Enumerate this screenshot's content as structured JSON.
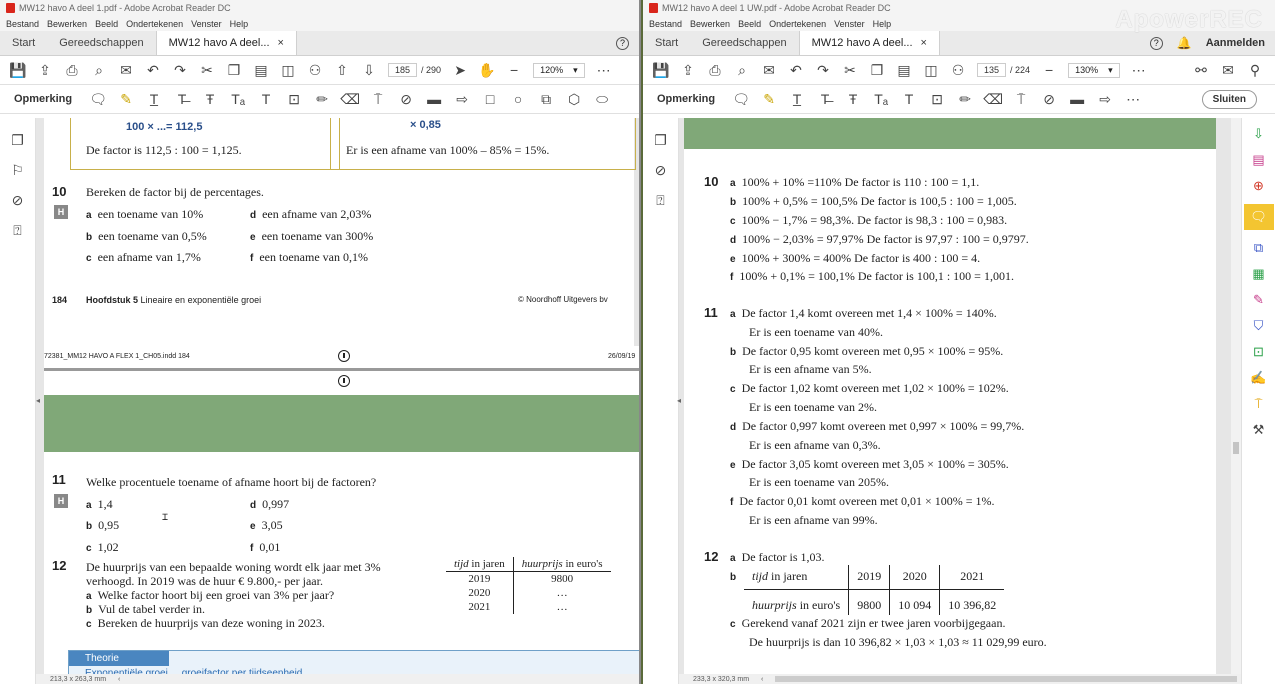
{
  "watermark": "ApowerREC",
  "left": {
    "title": "MW12 havo A deel 1.pdf - Adobe Acrobat Reader DC",
    "menu": [
      "Bestand",
      "Bewerken",
      "Beeld",
      "Ondertekenen",
      "Venster",
      "Help"
    ],
    "tabs": {
      "start": "Start",
      "tools": "Gereedschappen",
      "doc": "MW12 havo A deel...",
      "close": "×"
    },
    "page_current": "185",
    "page_total": "/ 290",
    "zoom": "120%",
    "annot_label": "Opmerking",
    "content": {
      "top_eq_left": "100 × ...= 112,5",
      "top_eq_right": "× 0,85",
      "factor_left": "De factor is 112,5 : 100 = 1,125.",
      "factor_right": "Er is een afname van 100% – 85% = 15%.",
      "q10_num": "10",
      "q10_text": "Bereken de factor bij de percentages.",
      "q10_items": [
        {
          "l": "a",
          "t": "een toename van 10%"
        },
        {
          "l": "d",
          "t": "een afname van 2,03%"
        },
        {
          "l": "b",
          "t": "een toename van 0,5%"
        },
        {
          "l": "e",
          "t": "een toename van 300%"
        },
        {
          "l": "c",
          "t": "een afname van 1,7%"
        },
        {
          "l": "f",
          "t": "een toename van 0,1%"
        }
      ],
      "h_label": "H",
      "footer_page": "184",
      "footer_chapter_bold": "Hoofdstuk 5",
      "footer_chapter": "Lineaire en exponentiële groei",
      "footer_publisher": "© Noordhoff Uitgevers bv",
      "indd_file": "72381_MM12 HAVO A FLEX 1_CH05.indd 184",
      "indd_date": "26/09/19",
      "q11_num": "11",
      "q11_text": "Welke procentuele toename of afname hoort bij de factoren?",
      "q11_items": [
        {
          "l": "a",
          "t": "1,4"
        },
        {
          "l": "d",
          "t": "0,997"
        },
        {
          "l": "b",
          "t": "0,95"
        },
        {
          "l": "e",
          "t": "3,05"
        },
        {
          "l": "c",
          "t": "1,02"
        },
        {
          "l": "f",
          "t": "0,01"
        }
      ],
      "q12_num": "12",
      "q12_line1": "De huurprijs van een bepaalde woning wordt elk jaar met 3%",
      "q12_line2": "verhoogd. In 2019 was de huur € 9.800,- per jaar.",
      "q12_a": "Welke factor hoort bij een groei van 3% per jaar?",
      "q12_b": "Vul de tabel verder in.",
      "q12_c": "Bereken de huurprijs van deze woning in 2023.",
      "table_head_1a": "tijd",
      "table_head_1b": " in jaren",
      "table_head_2a": "huurprijs",
      "table_head_2b": " in euro's",
      "table_rows": [
        [
          "2019",
          "9800"
        ],
        [
          "2020",
          "…"
        ],
        [
          "2021",
          "…"
        ]
      ],
      "theorie": "Theorie",
      "theorie_sub": "Exponentiële groei ... groeifactor per tijdseenheid"
    },
    "status_size": "213,3 x 263,3 mm"
  },
  "right": {
    "title": "MW12 havo A deel 1 UW.pdf - Adobe Acrobat Reader DC",
    "menu": [
      "Bestand",
      "Bewerken",
      "Beeld",
      "Ondertekenen",
      "Venster",
      "Help"
    ],
    "tabs": {
      "start": "Start",
      "tools": "Gereedschappen",
      "doc": "MW12 havo A deel...",
      "close": "×"
    },
    "aanmelden": "Aanmelden",
    "page_current": "135",
    "page_total": "/ 224",
    "zoom": "130%",
    "annot_label": "Opmerking",
    "sluiten": "Sluiten",
    "content": {
      "a10_num": "10",
      "a10": [
        {
          "l": "a",
          "t": "100% + 10% =110% De factor is 110 : 100 = 1,1."
        },
        {
          "l": "b",
          "t": "100% + 0,5% = 100,5% De factor is 100,5 : 100 = 1,005."
        },
        {
          "l": "c",
          "t": "100% − 1,7% = 98,3%. De factor is 98,3 : 100 = 0,983."
        },
        {
          "l": "d",
          "t": "100% − 2,03% = 97,97% De factor is 97,97 : 100 = 0,9797."
        },
        {
          "l": "e",
          "t": "100% + 300% = 400% De factor is 400 : 100 = 4."
        },
        {
          "l": "f",
          "t": "100% + 0,1% = 100,1% De factor is 100,1 : 100 = 1,001."
        }
      ],
      "a11_num": "11",
      "a11": [
        {
          "l": "a",
          "t1": "De factor 1,4 komt overeen met 1,4 × 100% = 140%.",
          "t2": "Er is een toename van 40%."
        },
        {
          "l": "b",
          "t1": "De factor 0,95 komt overeen met 0,95 × 100% = 95%.",
          "t2": "Er is een afname van 5%."
        },
        {
          "l": "c",
          "t1": "De factor 1,02 komt overeen met 1,02 × 100% = 102%.",
          "t2": "Er is een toename van 2%."
        },
        {
          "l": "d",
          "t1": "De factor 0,997 komt overeen met 0,997 × 100% = 99,7%.",
          "t2": "Er is een afname van 0,3%."
        },
        {
          "l": "e",
          "t1": "De factor 3,05 komt overeen met 3,05 × 100% = 305%.",
          "t2": "Er is een toename van 205%."
        },
        {
          "l": "f",
          "t1": "De factor 0,01 komt overeen met 0,01 × 100% = 1%.",
          "t2": "Er is een afname van 99%."
        }
      ],
      "a12_num": "12",
      "a12_a": "De factor is 1,03.",
      "a12_table_row1_head_a": "tijd",
      "a12_table_row1_head_b": " in jaren",
      "a12_table_row2_head_a": "huurprijs",
      "a12_table_row2_head_b": " in euro's",
      "a12_years": [
        "2019",
        "2020",
        "2021"
      ],
      "a12_prices": [
        "9800",
        "10 094",
        "10 396,82"
      ],
      "a12_c1": "Gerekend vanaf 2021 zijn er twee jaren voorbijgegaan.",
      "a12_c2": "De huurprijs is dan 10 396,82 × 1,03 × 1,03 ≈ 11 029,99 euro."
    },
    "status_size": "233,3 x 320,3 mm"
  }
}
